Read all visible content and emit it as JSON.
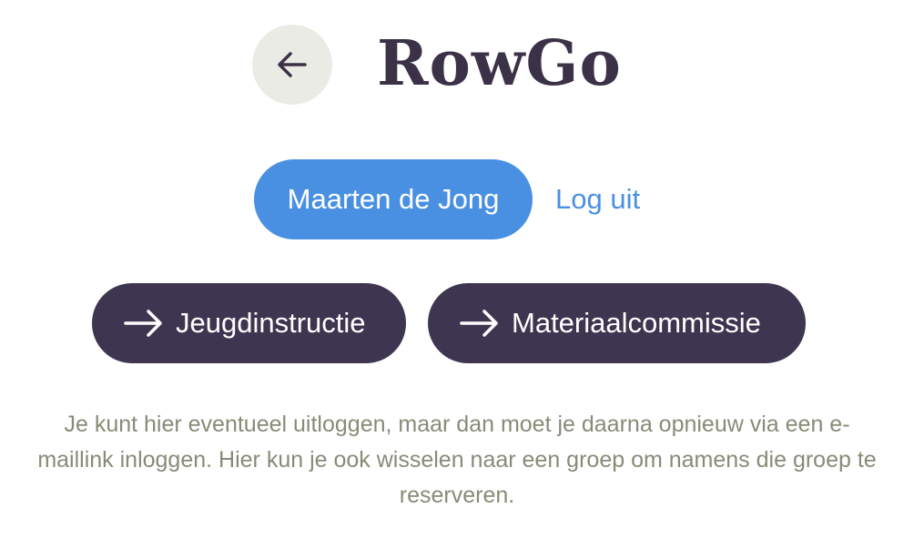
{
  "app": {
    "title": "RowGo"
  },
  "header": {
    "back_icon": "arrow-left-icon"
  },
  "account": {
    "user_name": "Maarten de Jong",
    "logout_label": "Log uit"
  },
  "groups": [
    {
      "label": "Jeugdinstructie",
      "icon": "arrow-right-icon"
    },
    {
      "label": "Materiaalcommissie",
      "icon": "arrow-right-icon"
    }
  ],
  "help": {
    "text": "Je kunt hier eventueel uitloggen, maar dan moet je daarna opnieuw via een e-maillink inloggen. Hier kun je ook wisselen naar een groep om namens die groep te reserveren."
  },
  "colors": {
    "accent_blue": "#4a90e2",
    "dark_purple": "#3e3650",
    "title_color": "#3c3248",
    "back_bg": "#ebebe6",
    "help_text": "#8a8a78"
  }
}
